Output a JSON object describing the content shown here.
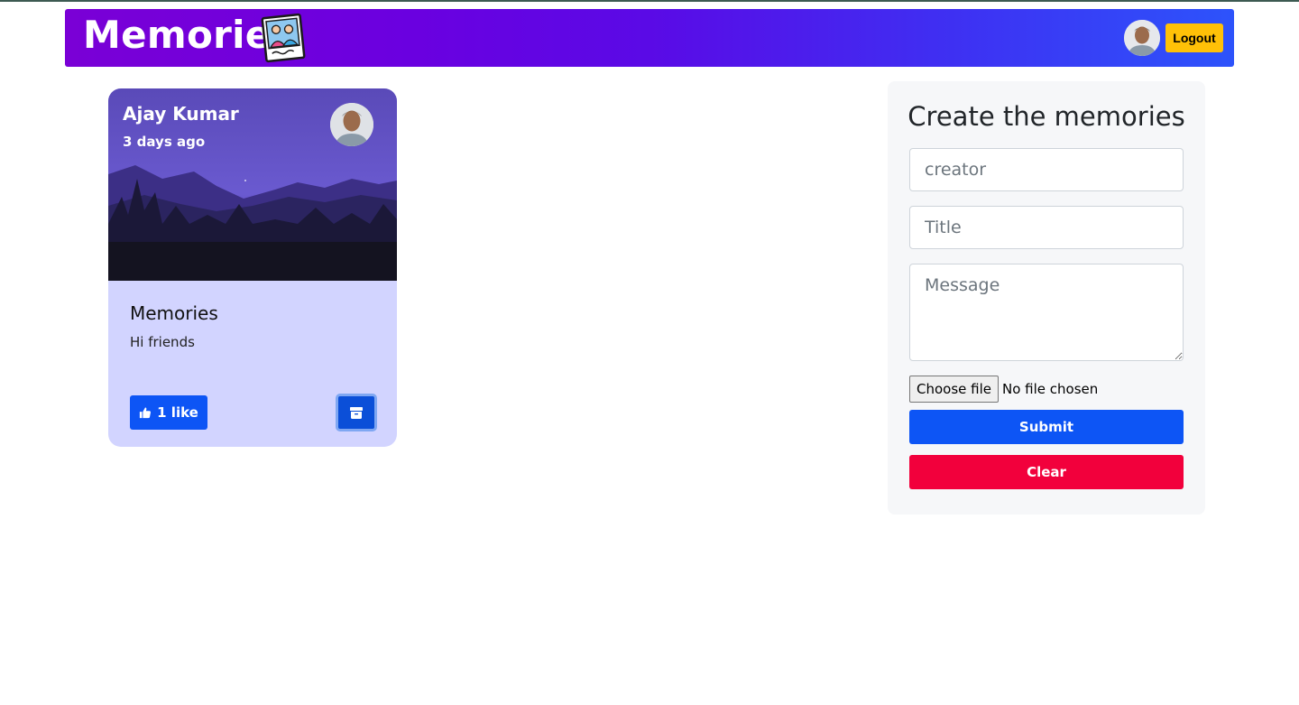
{
  "header": {
    "brand": "Memories",
    "logout_label": "Logout"
  },
  "posts": [
    {
      "author": "Ajay Kumar",
      "time": "3 days ago",
      "title": "Memories",
      "message": "Hi friends",
      "like_label": "1 like"
    }
  ],
  "form": {
    "title": "Create the memories",
    "creator_placeholder": "creator",
    "title_placeholder": "Title",
    "message_placeholder": "Message",
    "file_button_label": "Choose file",
    "file_status": "No file chosen",
    "submit_label": "Submit",
    "clear_label": "Clear"
  },
  "colors": {
    "header_gradient_start": "#7a00d6",
    "header_gradient_end": "#2d53fb",
    "logout": "#ffc107",
    "primary": "#0d55f5",
    "danger": "#f2003c",
    "card_body": "#d2d4ff"
  },
  "icons": {
    "brand": "memories-photo-icon",
    "like": "thumb-up-icon",
    "delete": "archive-box-icon"
  }
}
